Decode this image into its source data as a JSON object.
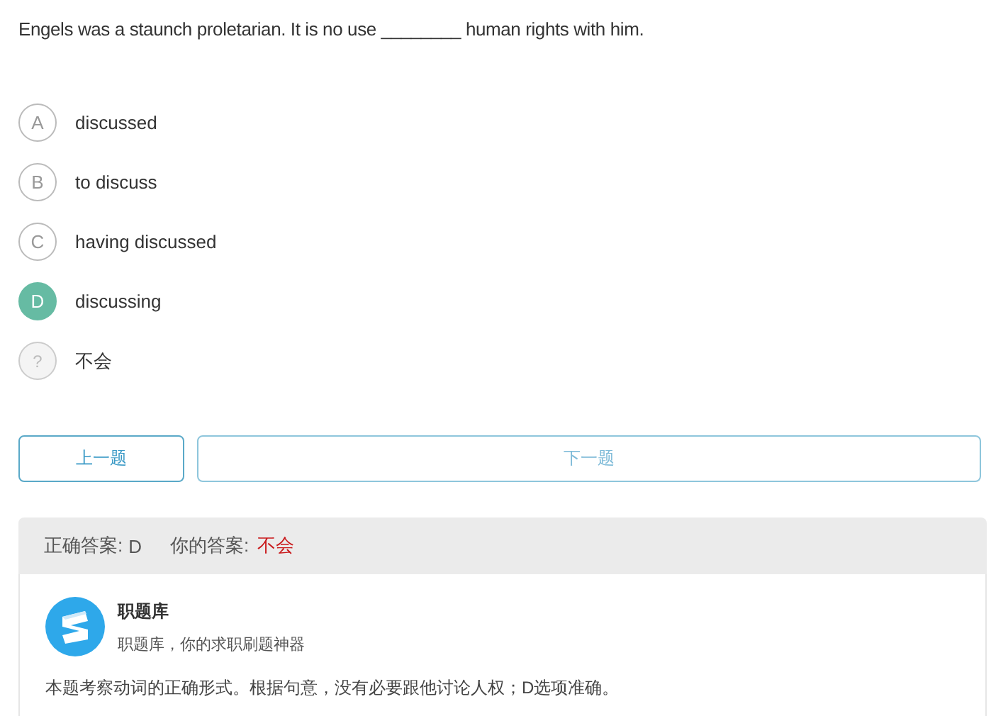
{
  "question": "Engels was a staunch proletarian. It is no use ________ human rights with him.",
  "options": [
    {
      "kind": "letter",
      "letter": "A",
      "text": "discussed",
      "selected": false
    },
    {
      "kind": "letter",
      "letter": "B",
      "text": "to discuss",
      "selected": false
    },
    {
      "kind": "letter",
      "letter": "C",
      "text": "having discussed",
      "selected": false
    },
    {
      "kind": "letter",
      "letter": "D",
      "text": "discussing",
      "selected": true
    },
    {
      "kind": "unknown",
      "letter": "?",
      "text": "不会",
      "selected": false
    }
  ],
  "buttons": {
    "previous": "上一题",
    "next": "下一题"
  },
  "answer": {
    "correct_label": "正确答案:",
    "correct_value": "D",
    "yours_label": "你的答案:",
    "yours_value": "不会"
  },
  "source": {
    "name": "职题库",
    "tagline": "职题库，你的求职刷题神器"
  },
  "explanation": "本题考察动词的正确形式。根据句意，没有必要跟他讨论人权；D选项准确。"
}
